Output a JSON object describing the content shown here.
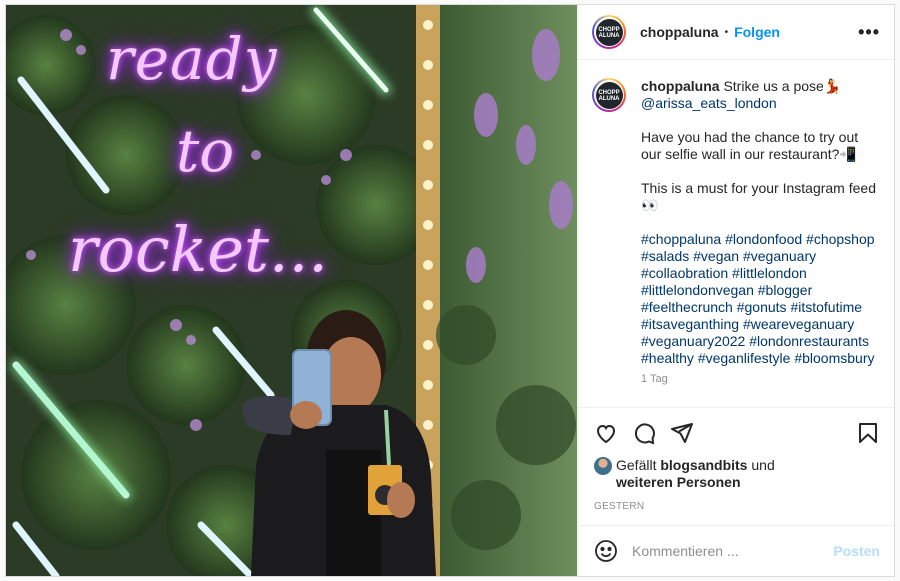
{
  "header": {
    "avatar_text": "CHOPP ALUNA",
    "username": "choppaluna",
    "separator": "•",
    "follow_label": "Folgen",
    "more_label": "•••"
  },
  "photo": {
    "neon_line_1": "ready",
    "neon_line_2": "to",
    "neon_line_3": "rocket...",
    "neon_color": "#d35cff"
  },
  "caption": {
    "username": "choppaluna",
    "line_1": " Strike us a pose💃",
    "mention": "@arissa_eats_london",
    "para_2": "Have you had the chance to try out our selfie wall in our restaurant?📲",
    "para_3": "This is a must for your Instagram feed 👀",
    "hashtags": "#choppaluna #londonfood #chopshop #salads #vegan #veganuary #collaobration #littlelondon #littlelondonvegan #blogger #feelthecrunch #gonuts #itstofutime #itsaveganthing #weareveganuary #veganuary2022 #londonrestaurants #healthy #veganlifestyle #bloomsbury",
    "time": "1 Tag"
  },
  "actions": {
    "like_icon": "heart-icon",
    "comment_icon": "comment-icon",
    "share_icon": "share-icon",
    "save_icon": "bookmark-icon"
  },
  "likes": {
    "prefix": "Gefällt ",
    "user": "blogsandbits",
    "middle": " und",
    "others": "weiteren Personen"
  },
  "timestamp": "GESTERN",
  "comment": {
    "placeholder": "Kommentieren ...",
    "post_label": "Posten",
    "post_color": "#b2dffc",
    "follow_color": "#0095f6"
  }
}
